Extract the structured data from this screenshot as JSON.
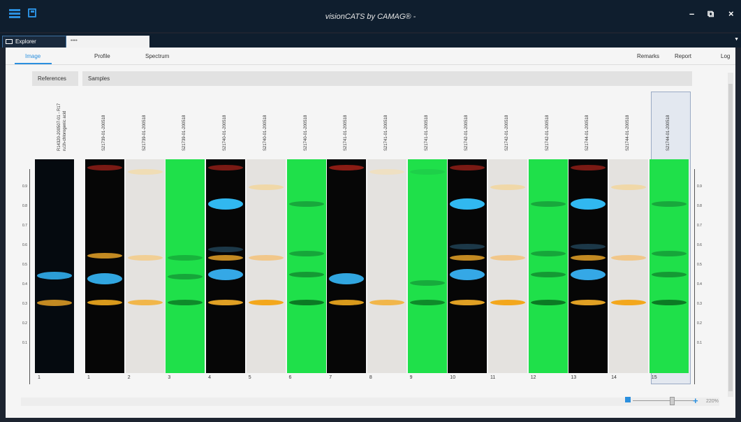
{
  "window": {
    "title": "visionCATS by CAMAG® -"
  },
  "tabs": {
    "explorer": "Explorer",
    "second": "••••"
  },
  "nav": {
    "image": "Image",
    "profile": "Profile",
    "spectrum": "Spectrum",
    "remarks": "Remarks",
    "report": "Report",
    "log": "Log"
  },
  "panels": {
    "references": "References",
    "samples": "Samples"
  },
  "reference": {
    "name": "R14320-200507-01 - R17",
    "name2": "ru1h-chlorogenic acid",
    "number": "1"
  },
  "samples": [
    {
      "name": "S21739-01-200518",
      "number": "1",
      "bg": "#060606",
      "bands": [
        {
          "y": 0.04,
          "c": "#7a1a14"
        },
        {
          "y": 0.45,
          "c": "#c38a22"
        },
        {
          "y": 0.56,
          "c": "#31a6e0",
          "big": true
        },
        {
          "y": 0.67,
          "c": "#d99a1c"
        }
      ]
    },
    {
      "name": "S21739-01-200518",
      "number": "2",
      "bg": "#e4e2df",
      "bands": [
        {
          "y": 0.06,
          "c": "#f0ddb5"
        },
        {
          "y": 0.46,
          "c": "#f1cf95"
        },
        {
          "y": 0.67,
          "c": "#f1b64a"
        }
      ]
    },
    {
      "name": "S21739-01-200518",
      "number": "3",
      "bg": "#1fe04a",
      "bands": [
        {
          "y": 0.46,
          "c": "#17b43c"
        },
        {
          "y": 0.55,
          "c": "#16a63a"
        },
        {
          "y": 0.67,
          "c": "#0f8a2a"
        }
      ]
    },
    {
      "name": "S21740-01-200518",
      "number": "4",
      "bg": "#060606",
      "bands": [
        {
          "y": 0.04,
          "c": "#7a1a14"
        },
        {
          "y": 0.21,
          "c": "#31b8f0",
          "big": true
        },
        {
          "y": 0.42,
          "c": "#1c3848"
        },
        {
          "y": 0.46,
          "c": "#c38a22"
        },
        {
          "y": 0.54,
          "c": "#35a8e6",
          "big": true
        },
        {
          "y": 0.67,
          "c": "#e0a024"
        }
      ]
    },
    {
      "name": "S21740-01-200518",
      "number": "5",
      "bg": "#e4e2df",
      "bands": [
        {
          "y": 0.13,
          "c": "#f0d8a8"
        },
        {
          "y": 0.46,
          "c": "#f1c78a"
        },
        {
          "y": 0.67,
          "c": "#f3a71c"
        }
      ]
    },
    {
      "name": "S21740-01-200518",
      "number": "6",
      "bg": "#1fe04a",
      "bands": [
        {
          "y": 0.21,
          "c": "#18a83c"
        },
        {
          "y": 0.44,
          "c": "#16a63a"
        },
        {
          "y": 0.54,
          "c": "#149a34"
        },
        {
          "y": 0.67,
          "c": "#0c7a24"
        }
      ]
    },
    {
      "name": "S21741-01-200518",
      "number": "7",
      "bg": "#060606",
      "bands": [
        {
          "y": 0.04,
          "c": "#8a1c14"
        },
        {
          "y": 0.56,
          "c": "#31a6e0",
          "big": true
        },
        {
          "y": 0.67,
          "c": "#d99a1c"
        }
      ]
    },
    {
      "name": "S21741-01-200518",
      "number": "8",
      "bg": "#e4e2df",
      "bands": [
        {
          "y": 0.06,
          "c": "#efe0c2"
        },
        {
          "y": 0.67,
          "c": "#f1b64a"
        }
      ]
    },
    {
      "name": "S21741-01-200518",
      "number": "9",
      "bg": "#1fe04a",
      "bands": [
        {
          "y": 0.06,
          "c": "#1ed049"
        },
        {
          "y": 0.58,
          "c": "#17ab3c"
        },
        {
          "y": 0.67,
          "c": "#0f8a2a"
        }
      ]
    },
    {
      "name": "S21742-01-200518",
      "number": "10",
      "bg": "#060606",
      "bands": [
        {
          "y": 0.04,
          "c": "#7a1a14"
        },
        {
          "y": 0.21,
          "c": "#31b8f0",
          "big": true
        },
        {
          "y": 0.41,
          "c": "#1c3848"
        },
        {
          "y": 0.46,
          "c": "#c38a22"
        },
        {
          "y": 0.54,
          "c": "#35a8e6",
          "big": true
        },
        {
          "y": 0.67,
          "c": "#e0a024"
        }
      ]
    },
    {
      "name": "S21742-01-200518",
      "number": "11",
      "bg": "#e4e2df",
      "bands": [
        {
          "y": 0.13,
          "c": "#f0d8a8"
        },
        {
          "y": 0.46,
          "c": "#f1c78a"
        },
        {
          "y": 0.67,
          "c": "#f3a71c"
        }
      ]
    },
    {
      "name": "S21742-01-200518",
      "number": "12",
      "bg": "#1fe04a",
      "bands": [
        {
          "y": 0.21,
          "c": "#18a83c"
        },
        {
          "y": 0.44,
          "c": "#16a63a"
        },
        {
          "y": 0.54,
          "c": "#149a34"
        },
        {
          "y": 0.67,
          "c": "#0c7a24"
        }
      ]
    },
    {
      "name": "S21744-01-200518",
      "number": "13",
      "bg": "#060606",
      "bands": [
        {
          "y": 0.04,
          "c": "#7a1a14"
        },
        {
          "y": 0.21,
          "c": "#31b8f0",
          "big": true
        },
        {
          "y": 0.41,
          "c": "#1c3848"
        },
        {
          "y": 0.46,
          "c": "#c38a22"
        },
        {
          "y": 0.54,
          "c": "#35a8e6",
          "big": true
        },
        {
          "y": 0.67,
          "c": "#e0a024"
        }
      ]
    },
    {
      "name": "S21744-01-200518",
      "number": "14",
      "bg": "#e4e2df",
      "bands": [
        {
          "y": 0.13,
          "c": "#f0d8a8"
        },
        {
          "y": 0.46,
          "c": "#f1c78a"
        },
        {
          "y": 0.67,
          "c": "#f3a71c"
        }
      ]
    },
    {
      "name": "S21744-01-200518",
      "number": "15",
      "bg": "#1fe04a",
      "bands": [
        {
          "y": 0.21,
          "c": "#18a83c"
        },
        {
          "y": 0.44,
          "c": "#16a63a"
        },
        {
          "y": 0.54,
          "c": "#149a34"
        },
        {
          "y": 0.67,
          "c": "#0c7a24"
        }
      ]
    }
  ],
  "axis": {
    "left_ticks": [
      "0.9",
      "0.8",
      "0.7",
      "0.6",
      "0.5",
      "0.4",
      "0.3",
      "0.2",
      "0.1"
    ],
    "right_ticks": [
      "0.9",
      "0.8",
      "0.7",
      "0.6",
      "0.5",
      "0.4",
      "0.3",
      "0.2",
      "0.1"
    ]
  },
  "zoom": {
    "level": "220%"
  }
}
